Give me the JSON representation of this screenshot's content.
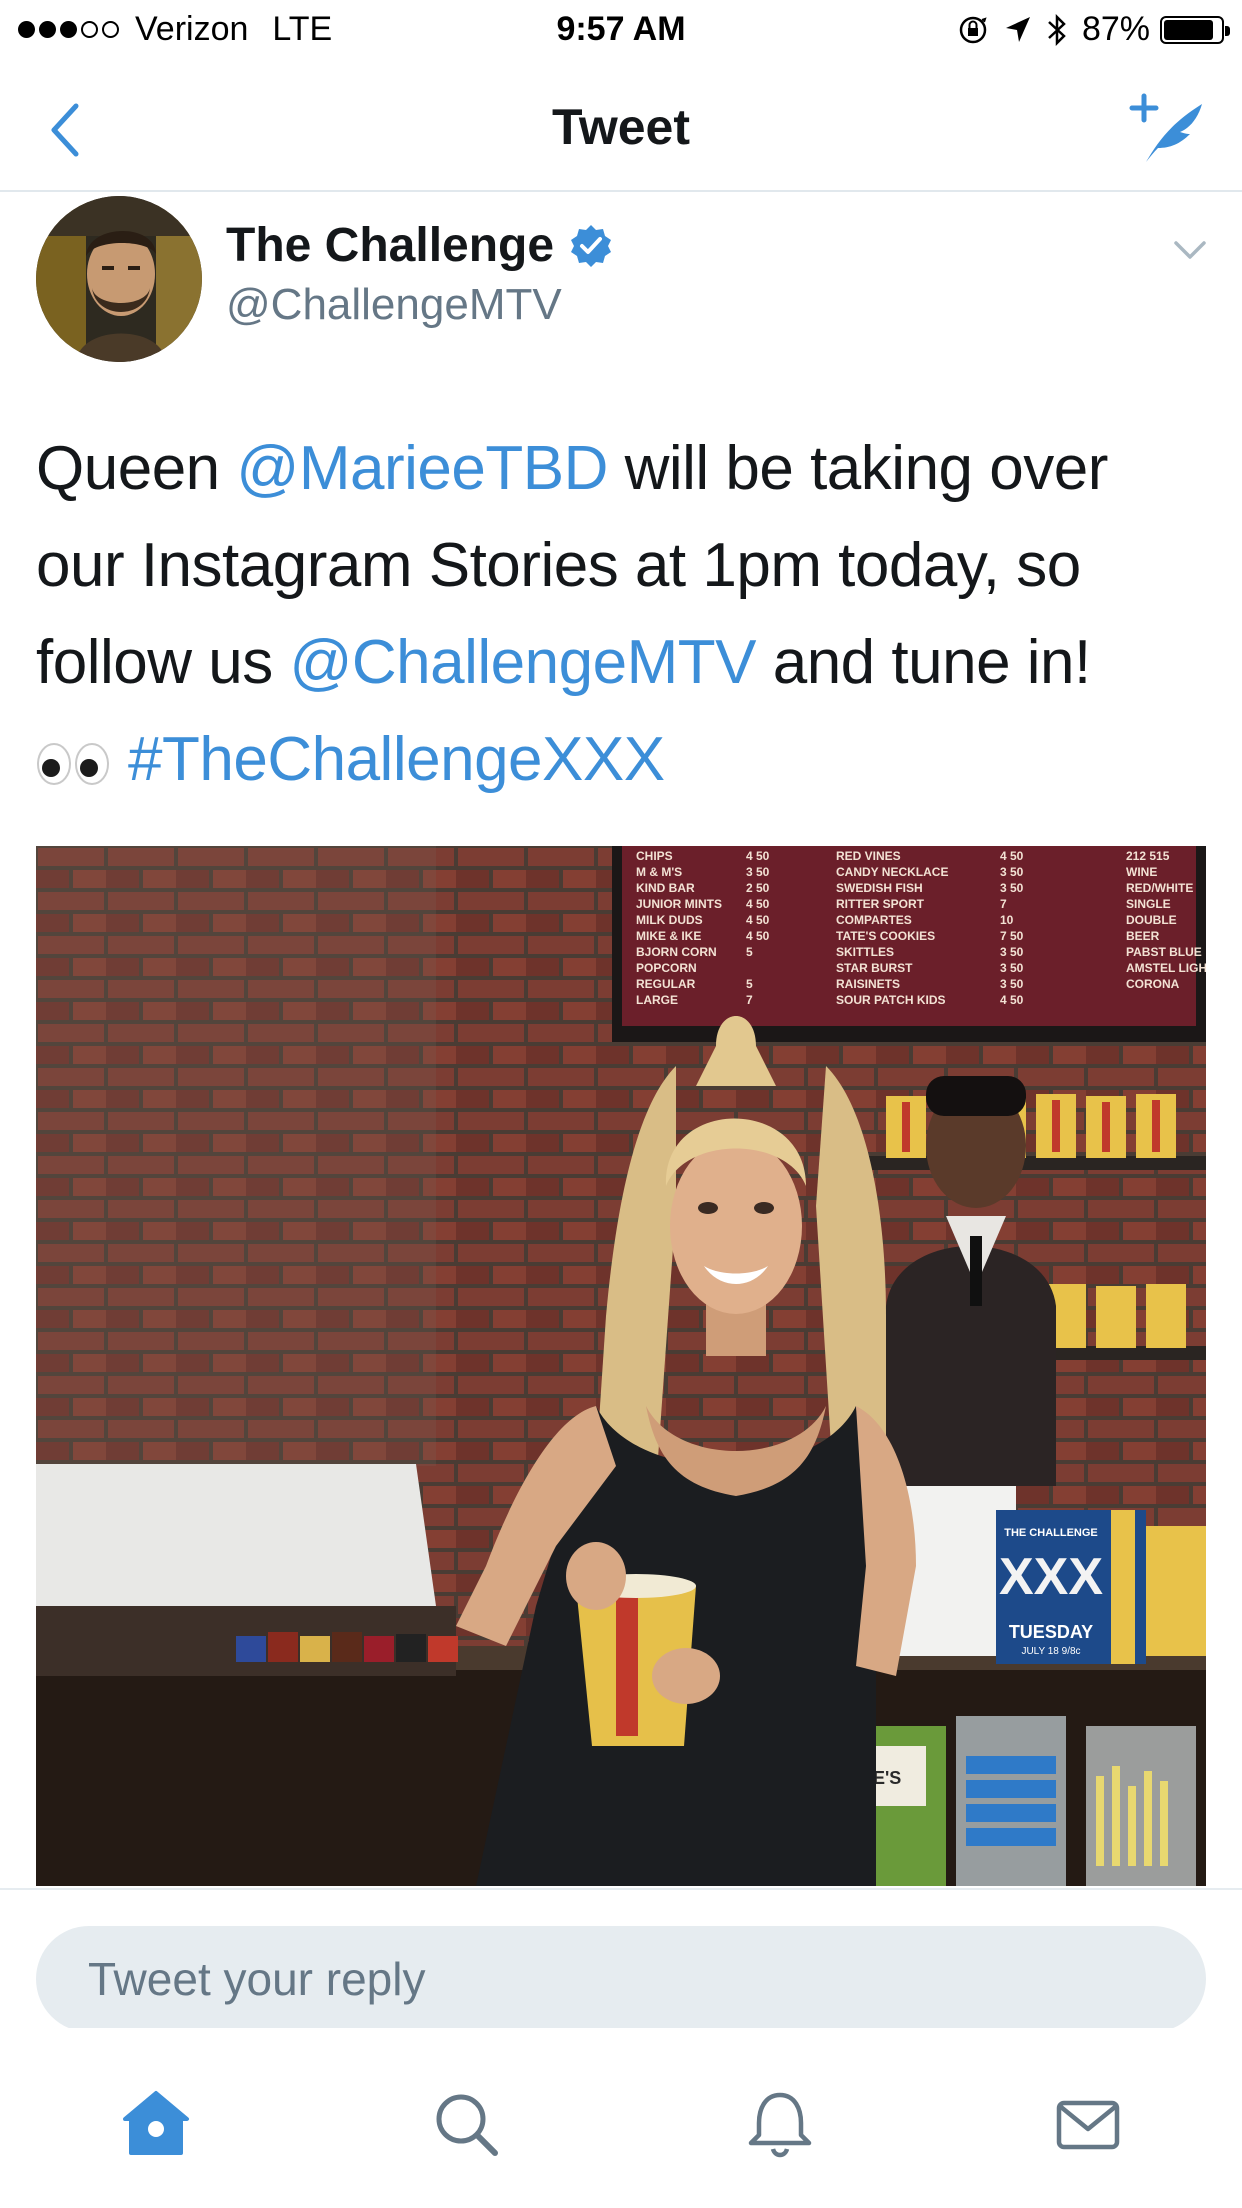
{
  "status_bar": {
    "carrier": "Verizon",
    "network": "LTE",
    "time": "9:57 AM",
    "battery": "87%",
    "battery_level": 0.87,
    "signal_bars_filled": 3,
    "signal_bars_total": 5
  },
  "nav": {
    "title": "Tweet",
    "back_icon": "chevron-left-icon",
    "compose_icon": "compose-tweet-icon"
  },
  "tweet": {
    "author_name": "The Challenge",
    "author_handle": "@ChallengeMTV",
    "verified": true,
    "text": {
      "line1_a": "Queen ",
      "line1_mention": "@MarieeTBD",
      "line1_b": " will be taking over",
      "line2": "our Instagram Stories at 1pm today, so",
      "line3_a": "follow us ",
      "line3_mention": "@ChallengeMTV",
      "line3_b": " and tune in!",
      "line4_hashtag": "#TheChallengeXXX"
    }
  },
  "photo": {
    "menu_items": [
      "CHIPS",
      "M & M'S",
      "KIND BAR",
      "JUNIOR MINTS",
      "MILK DUDS",
      "MIKE & IKE",
      "BJORN CORN",
      "POPCORN",
      "REGULAR",
      "LARGE"
    ],
    "menu_prices": [
      "4 50",
      "3 50",
      "2 50",
      "4 50",
      "4 50",
      "4 50",
      "5",
      "",
      "5",
      "7"
    ],
    "menu_items_2": [
      "RED VINES",
      "CANDY NECKLACE",
      "SWEDISH FISH",
      "RITTER SPORT",
      "COMPARTES",
      "TATE'S COOKIES",
      "SKITTLES",
      "STAR BURST",
      "RAISINETS",
      "SOUR PATCH KIDS"
    ],
    "menu_prices_2": [
      "4 50",
      "3 50",
      "3 50",
      "7",
      "10",
      "7 50",
      "3 50",
      "3 50",
      "3 50",
      "4 50"
    ],
    "menu_items_3": [
      "212 515",
      "WINE",
      "RED/WHITE",
      "SINGLE",
      "DOUBLE",
      "BEER",
      "PABST BLUE",
      "AMSTEL LIGHT",
      "CORONA"
    ],
    "sign_top": "THE CHALLENGE",
    "sign_main": "XXX",
    "sign_sub": "TUESDAY",
    "sign_time": "JULY 18 9/8c",
    "bag_label": "TATE'S"
  },
  "reply": {
    "placeholder": "Tweet your reply"
  },
  "tab_bar": {
    "items": [
      "home-icon",
      "search-icon",
      "notifications-icon",
      "messages-icon"
    ],
    "active": "home-icon"
  },
  "colors": {
    "accent": "#3c8ed8",
    "text": "#14171a",
    "muted": "#657786",
    "divider": "#e1e8ed",
    "reply_bg": "#e6ecf0",
    "tab_inactive": "#657786"
  }
}
